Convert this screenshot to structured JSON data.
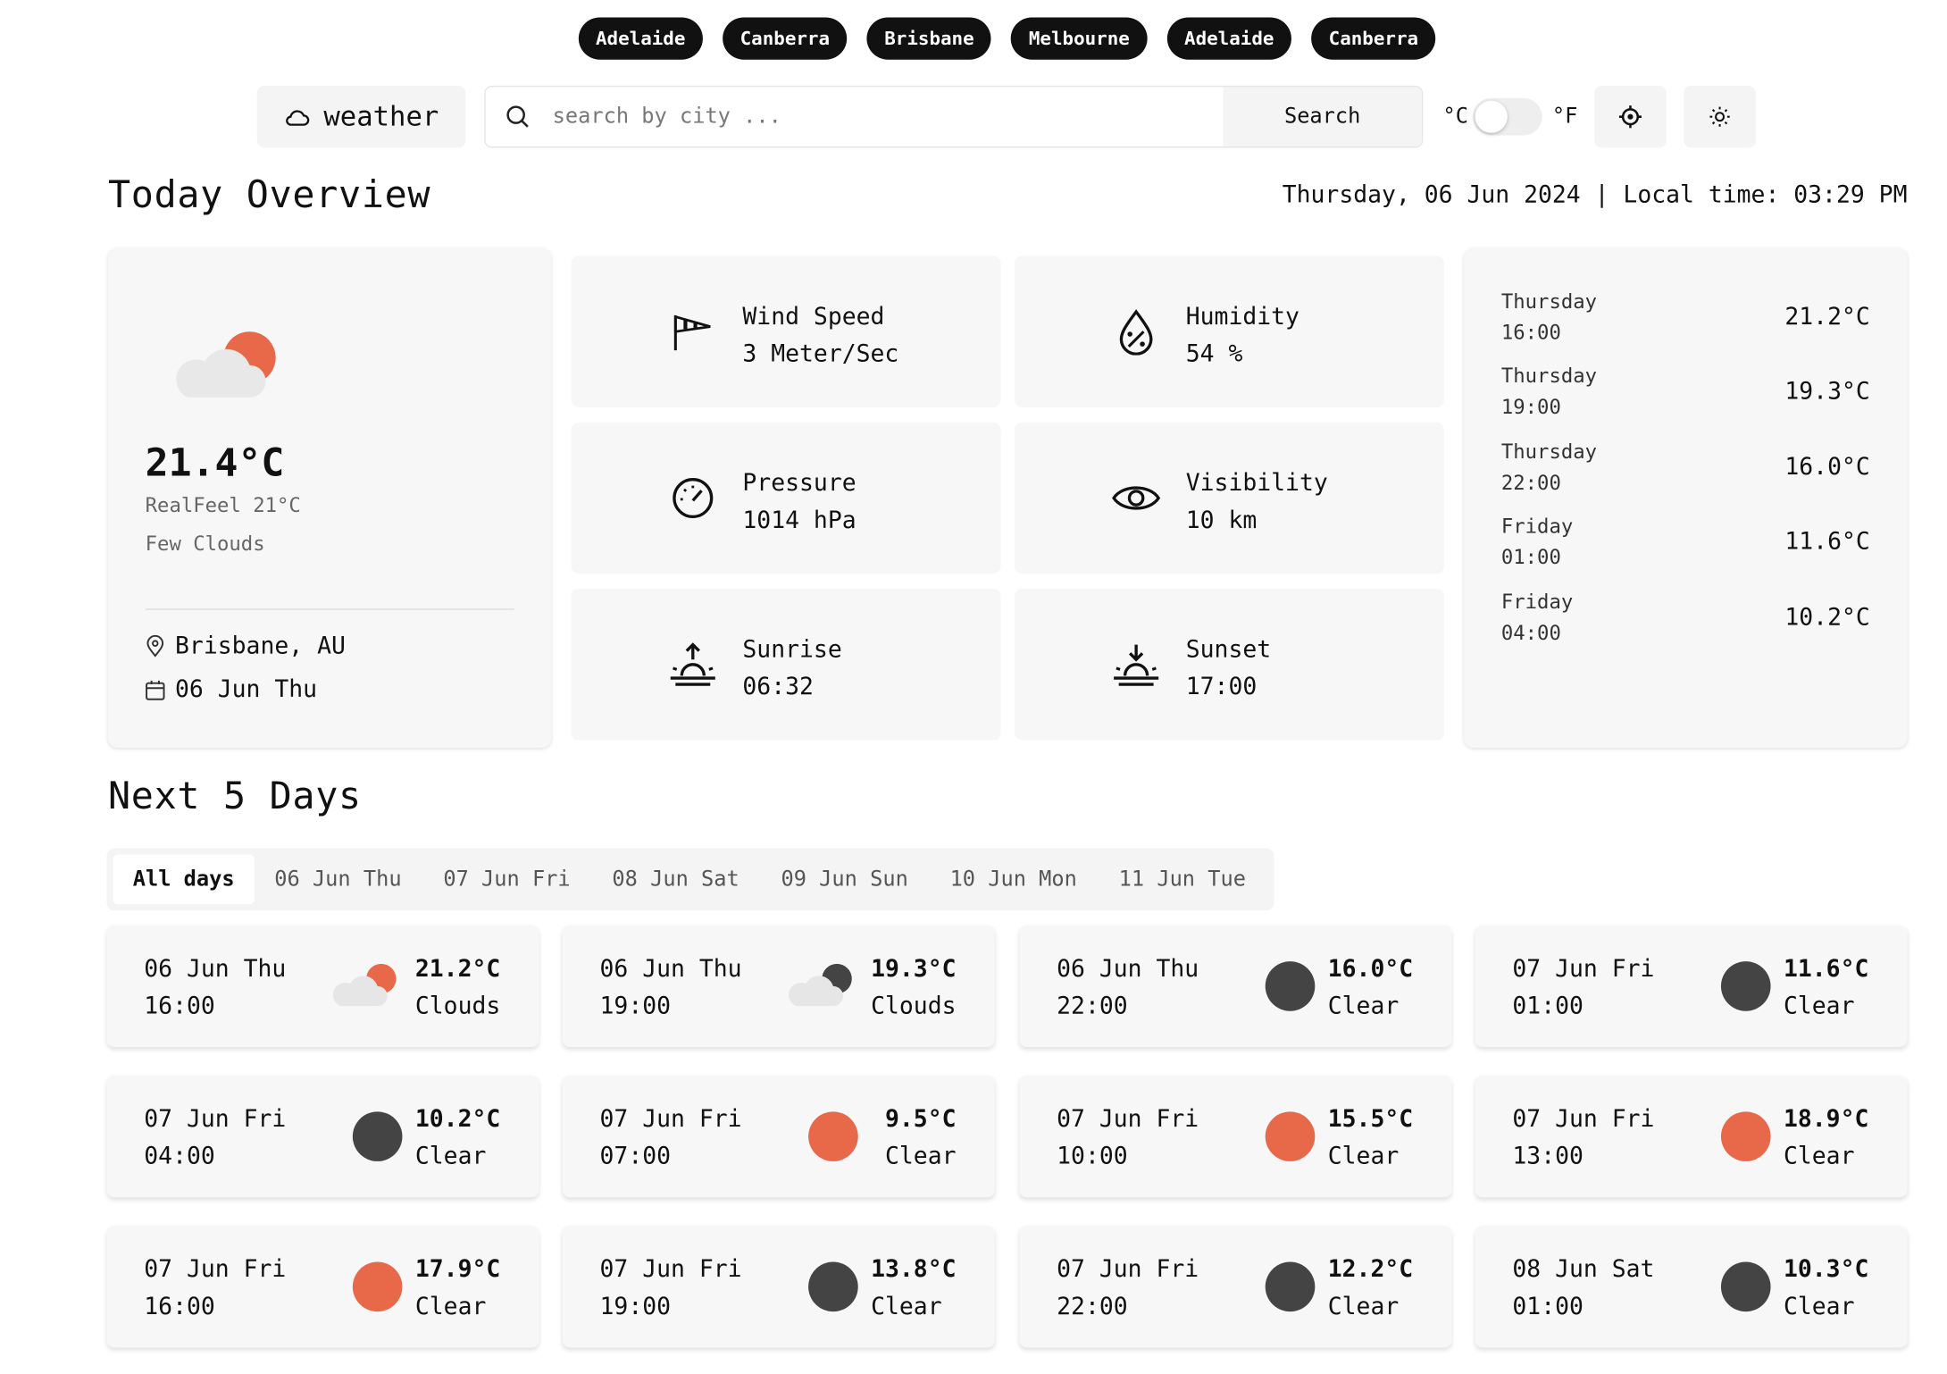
{
  "cities": [
    "Adelaide",
    "Canberra",
    "Brisbane",
    "Melbourne",
    "Adelaide",
    "Canberra"
  ],
  "brand": "weather",
  "search": {
    "placeholder": "search by city ...",
    "button": "Search"
  },
  "units": {
    "c": "°C",
    "f": "°F"
  },
  "today_title": "Today Overview",
  "datetime": "Thursday, 06 Jun 2024 | Local time: 03:29 PM",
  "current": {
    "temp": "21.4°C",
    "realfeel": "RealFeel 21°C",
    "desc": "Few Clouds",
    "location": "Brisbane, AU",
    "date": "06 Jun Thu"
  },
  "stats": [
    {
      "icon": "wind-icon",
      "label": "Wind Speed",
      "value": "3 Meter/Sec"
    },
    {
      "icon": "humidity-icon",
      "label": "Humidity",
      "value": "54 %"
    },
    {
      "icon": "gauge-icon",
      "label": "Pressure",
      "value": "1014 hPa"
    },
    {
      "icon": "eye-icon",
      "label": "Visibility",
      "value": "10 km"
    },
    {
      "icon": "sunrise-icon",
      "label": "Sunrise",
      "value": "06:32"
    },
    {
      "icon": "sunset-icon",
      "label": "Sunset",
      "value": "17:00"
    }
  ],
  "hourly": [
    {
      "day": "Thursday",
      "time": "16:00",
      "temp": "21.2°C"
    },
    {
      "day": "Thursday",
      "time": "19:00",
      "temp": "19.3°C"
    },
    {
      "day": "Thursday",
      "time": "22:00",
      "temp": "16.0°C"
    },
    {
      "day": "Friday",
      "time": "01:00",
      "temp": "11.6°C"
    },
    {
      "day": "Friday",
      "time": "04:00",
      "temp": "10.2°C"
    }
  ],
  "next_title": "Next 5 Days",
  "tabs": [
    "All days",
    "06 Jun Thu",
    "07 Jun Fri",
    "08 Jun Sat",
    "09 Jun Sun",
    "10 Jun Mon",
    "11 Jun Tue"
  ],
  "forecast": [
    {
      "date": "06 Jun Thu",
      "time": "16:00",
      "temp": "21.2°C",
      "desc": "Clouds",
      "icon": "cloud-sun-icon"
    },
    {
      "date": "06 Jun Thu",
      "time": "19:00",
      "temp": "19.3°C",
      "desc": "Clouds",
      "icon": "cloud-moon-icon"
    },
    {
      "date": "06 Jun Thu",
      "time": "22:00",
      "temp": "16.0°C",
      "desc": "Clear",
      "icon": "moon-icon"
    },
    {
      "date": "07 Jun Fri",
      "time": "01:00",
      "temp": "11.6°C",
      "desc": "Clear",
      "icon": "moon-icon"
    },
    {
      "date": "07 Jun Fri",
      "time": "04:00",
      "temp": "10.2°C",
      "desc": "Clear",
      "icon": "moon-icon"
    },
    {
      "date": "07 Jun Fri",
      "time": "07:00",
      "temp": "9.5°C",
      "desc": "Clear",
      "icon": "sun-icon"
    },
    {
      "date": "07 Jun Fri",
      "time": "10:00",
      "temp": "15.5°C",
      "desc": "Clear",
      "icon": "sun-icon"
    },
    {
      "date": "07 Jun Fri",
      "time": "13:00",
      "temp": "18.9°C",
      "desc": "Clear",
      "icon": "sun-icon"
    },
    {
      "date": "07 Jun Fri",
      "time": "16:00",
      "temp": "17.9°C",
      "desc": "Clear",
      "icon": "sun-icon"
    },
    {
      "date": "07 Jun Fri",
      "time": "19:00",
      "temp": "13.8°C",
      "desc": "Clear",
      "icon": "moon-icon"
    },
    {
      "date": "07 Jun Fri",
      "time": "22:00",
      "temp": "12.2°C",
      "desc": "Clear",
      "icon": "moon-icon"
    },
    {
      "date": "08 Jun Sat",
      "time": "01:00",
      "temp": "10.3°C",
      "desc": "Clear",
      "icon": "moon-icon"
    }
  ],
  "colors": {
    "sun": "#e8694a",
    "moon": "#444444",
    "cloud": "#e6e6e6",
    "chip": "#111111"
  }
}
